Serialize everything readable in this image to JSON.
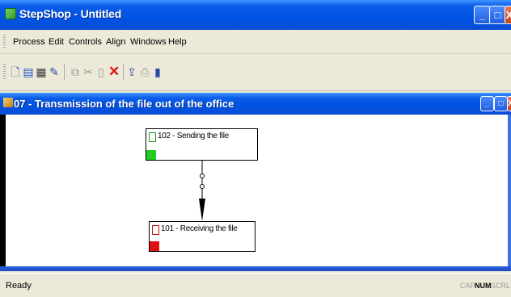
{
  "window": {
    "title": "StepShop - Untitled",
    "controls": {
      "minimize": "_",
      "maximize": "□",
      "close": "X"
    }
  },
  "menu": [
    "Process",
    "Edit",
    "Controls",
    "Align",
    "Windows",
    "Help"
  ],
  "toolbar": {
    "buttons": [
      {
        "name": "new-process-icon",
        "glyph": "🗋"
      },
      {
        "name": "open-icon",
        "glyph": "▤"
      },
      {
        "name": "list-icon",
        "glyph": "▦"
      },
      {
        "name": "properties-icon",
        "glyph": "✎"
      },
      {
        "name": "copy-icon",
        "glyph": "⧉"
      },
      {
        "name": "cut-icon",
        "glyph": "✂"
      },
      {
        "name": "paste-icon",
        "glyph": "▯"
      },
      {
        "name": "delete-icon",
        "glyph": "✕"
      },
      {
        "name": "export-icon",
        "glyph": "⇪"
      },
      {
        "name": "print-icon",
        "glyph": "⎙"
      },
      {
        "name": "book-icon",
        "glyph": "▮"
      }
    ]
  },
  "child_window": {
    "title": "07 - Transmission of the file out of the office"
  },
  "diagram": {
    "nodes": [
      {
        "id": "102",
        "label": "102 - Sending the file",
        "status_color": "#22cc22"
      },
      {
        "id": "101",
        "label": "101 - Receiving the file",
        "status_color": "#e01010"
      }
    ]
  },
  "status_bar": {
    "text": "Ready",
    "indicators": [
      {
        "label": "CAP",
        "active": false
      },
      {
        "label": "NUM",
        "active": true
      },
      {
        "label": "SCRL",
        "active": false
      }
    ]
  }
}
